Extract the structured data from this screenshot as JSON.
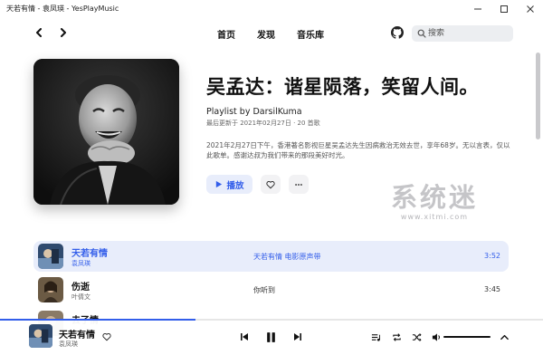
{
  "window": {
    "title": "天若有情 - 袁凤瑛 - YesPlayMusic"
  },
  "nav": {
    "links": [
      "首页",
      "发现",
      "音乐库"
    ],
    "search_placeholder": "搜索"
  },
  "playlist": {
    "title": "吴孟达：谐星陨落，笑留人间。",
    "subtitle": "Playlist by DarsilKuma",
    "meta": "最后更新于 2021年02月27日 · 20 首歌",
    "description": "2021年2月27日下午，香港著名影视巨星吴孟达先生因病救治无效去世，享年68岁。无以言表，仅以此歌单。感谢达叔为我们带来的那段美好时光。",
    "play_label": "播放"
  },
  "watermark": {
    "main": "系统迷",
    "url": "www.xitmi.com"
  },
  "tracks": [
    {
      "name": "天若有情",
      "artist": "袁凤瑛",
      "album": "天若有情 电影原声带",
      "duration": "3:52",
      "active": true
    },
    {
      "name": "伤逝",
      "artist": "叶倩文",
      "album": "你听到",
      "duration": "3:45",
      "active": false
    },
    {
      "name": "去了情",
      "artist": "",
      "album": "",
      "duration": "",
      "active": false
    }
  ],
  "player": {
    "track_name": "天若有情",
    "artist": "袁凤瑛",
    "progress": 0.36
  },
  "colors": {
    "accent": "#335eea",
    "accent_bg": "#e8edfb"
  }
}
